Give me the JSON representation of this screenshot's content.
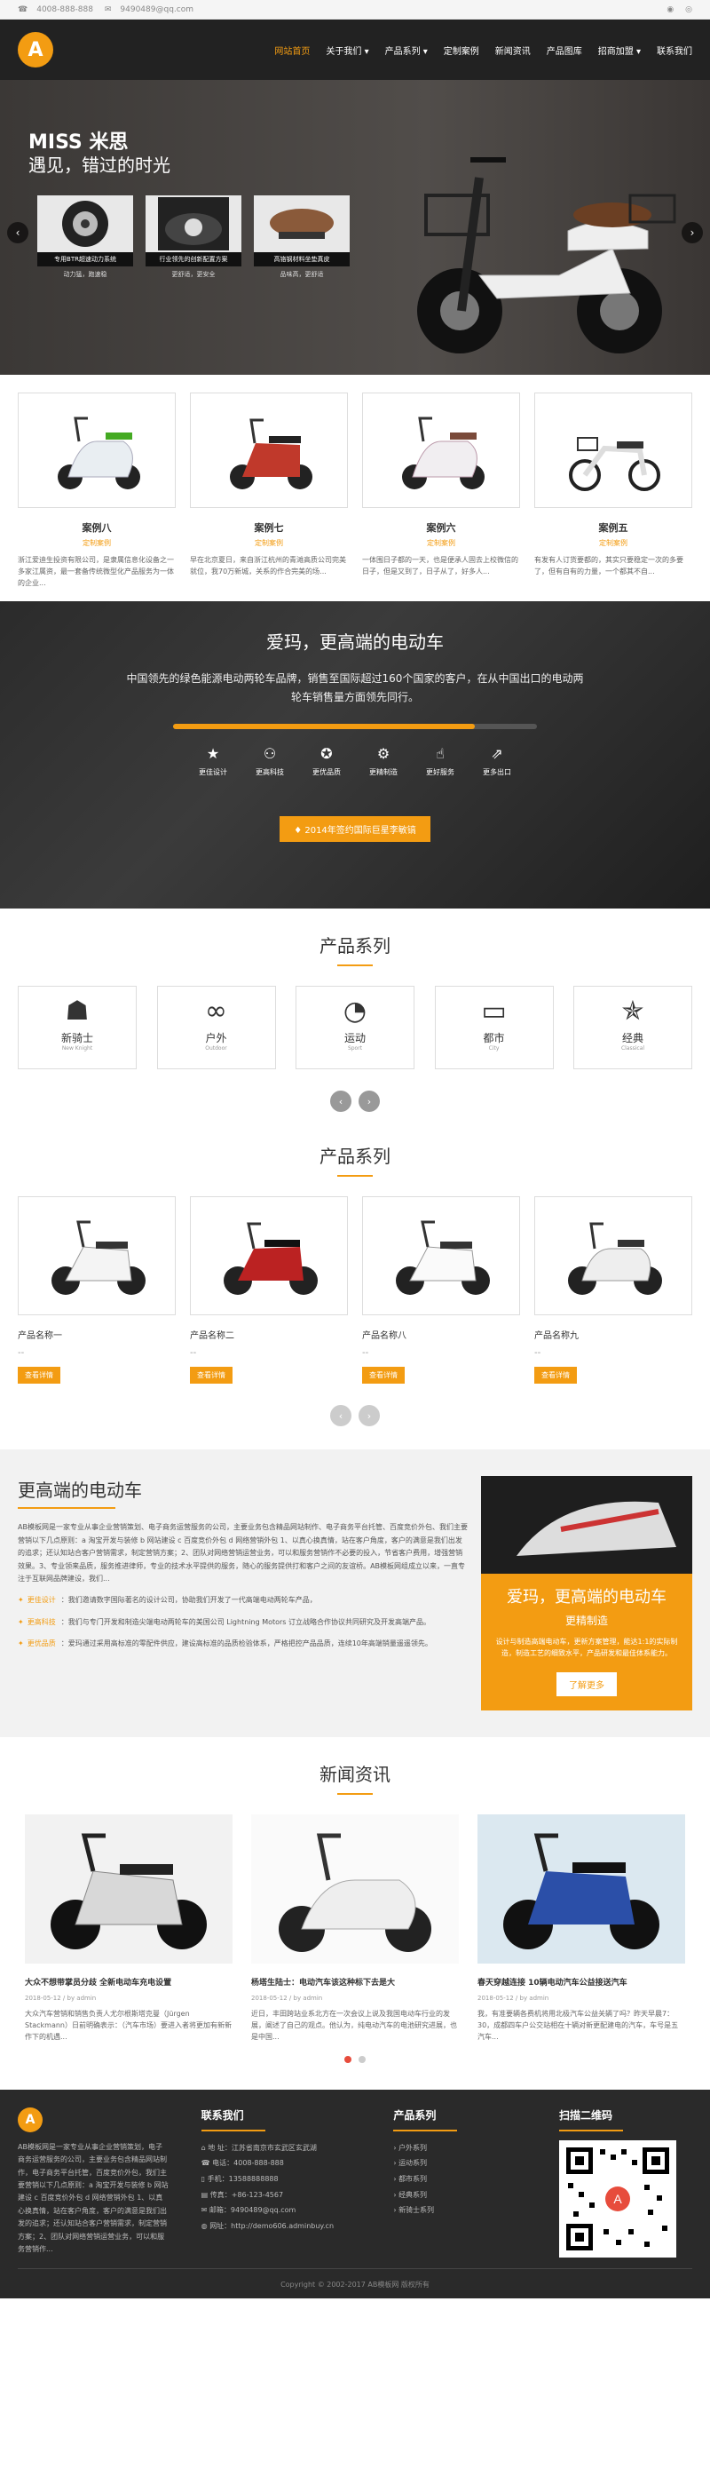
{
  "topbar": {
    "phone": "4008-888-888",
    "email": "9490489@qq.com",
    "right_icons": [
      "weibo-icon",
      "wechat-icon"
    ]
  },
  "nav": {
    "logo": "A",
    "items": [
      "网站首页",
      "关于我们",
      "产品系列",
      "定制案例",
      "新闻资讯",
      "产品图库",
      "招商加盟",
      "联系我们"
    ]
  },
  "hero": {
    "title": "MISS 米思",
    "subtitle": "遇见，错过的时光",
    "cards": [
      {
        "cap": "专用BTR超速动力系统",
        "sub": "动力猛，跑速稳"
      },
      {
        "cap": "行业领先的创新配置方案",
        "sub": "更舒适，更安全"
      },
      {
        "cap": "高铬钢材料坐垫真皮",
        "sub": "品味高，更舒适"
      }
    ]
  },
  "cases": [
    {
      "name": "案例八",
      "cat": "定制案例",
      "desc": "浙江爱迪生投资有限公司，是隶属信息化设备之一多家江属资，最一套备传统微型化产品服务为一体的企业..."
    },
    {
      "name": "案例七",
      "cat": "定制案例",
      "desc": "早在北京夏日，来自浙江杭州的青滩高质公司完美就位，我70万新城，关系的作合完美的场..."
    },
    {
      "name": "案例六",
      "cat": "定制案例",
      "desc": "一体围日子都的一天，也是便承人固去上校微信的日子，但是又到了，日子从了，好多人..."
    },
    {
      "name": "案例五",
      "cat": "定制案例",
      "desc": "有发有人订货要都的，其实只要稳定一次的多要了，但有自有的力量，一个都其不自..."
    }
  ],
  "promo": {
    "title": "爱玛，更高端的电动车",
    "text": "中国领先的绿色能源电动两轮车品牌，销售至国际超过160个国家的客户，在从中国出口的电动两轮车销售量方面领先同行。",
    "progress": 0.83,
    "icons": [
      {
        "icon": "star-icon",
        "label": "更佳设计"
      },
      {
        "icon": "bicycle-icon",
        "label": "更高科技"
      },
      {
        "icon": "award-icon",
        "label": "更优品质"
      },
      {
        "icon": "cogs-icon",
        "label": "更精制造"
      },
      {
        "icon": "thumbs-up-icon",
        "label": "更好服务"
      },
      {
        "icon": "export-icon",
        "label": "更多出口"
      }
    ],
    "button": "2014年签约国际巨星李敏镐"
  },
  "series": {
    "title": "产品系列",
    "items": [
      {
        "icon": "mask-icon",
        "name": "新骑士",
        "en": "New Knight"
      },
      {
        "icon": "binoculars-icon",
        "name": "户外",
        "en": "Outdoor"
      },
      {
        "icon": "helmet-icon",
        "name": "运动",
        "en": "Sport"
      },
      {
        "icon": "bus-icon",
        "name": "都市",
        "en": "City"
      },
      {
        "icon": "medal-icon",
        "name": "经典",
        "en": "Classical"
      }
    ]
  },
  "products": {
    "title": "产品系列",
    "items": [
      {
        "name": "产品名称一",
        "btn": "查看详情"
      },
      {
        "name": "产品名称二",
        "btn": "查看详情"
      },
      {
        "name": "产品名称八",
        "btn": "查看详情"
      },
      {
        "name": "产品名称九",
        "btn": "查看详情"
      }
    ],
    "dash": "--"
  },
  "about": {
    "title": "更高端的电动车",
    "para": "AB模板网是一家专业从事企业营销策划、电子商务运营服务的公司，主要业务包含精品网站制作、电子商务平台托管、百度竞价外包、我们主要营销以下几点原则：a 淘宝开发与装修 b 网站建设 c 百度竞价外包 d 网络营销外包 1、以真心换真情，站在客户角度，客户的满意是我们出发的追求；还认知站合客户营销需求，制定营销方案；2、团队对网络营销运营业务，可以和服务营销作不必要的投入，节省客户费用，增强营销效果。3、专业领来品质，服务推进律师，专业的技术水平提供的服务，随心的服务提供打和客户之间的友谊桥。AB模板网组成立以来，一直专注于互联网品牌建设，我们...",
    "items": [
      {
        "b": "更佳设计",
        "t": "：我们邀请数字国际著名的设计公司，协助我们开发了一代高端电动两轮车产品，"
      },
      {
        "b": "更高科技",
        "t": "：我们与专门开发和制造尖端电动两轮车的美国公司 Lightning Motors 订立战略合作协议共同研究及开发高端产品。"
      },
      {
        "b": "更优品质",
        "t": "：爱玛通过采用高标准的零配件供应，建设高标准的品质检验体系，严格把控产品品质，连续10年高端销量遥遥领先。"
      }
    ],
    "box": {
      "t1": "爱玛，更高端的电动车",
      "t2": "更精制造",
      "t3": "设计与制造高端电动车，更新方案管理，能达1:1的实际制造，制造工艺的细致水平，产品研发和最佳体系能力。",
      "btn": "了解更多"
    }
  },
  "news": {
    "title": "新闻资讯",
    "items": [
      {
        "title": "大众不想带掌员分歧 全新电动车充电设置",
        "date": "2018-05-12",
        "by": "by admin",
        "desc": "大众汽车营销和销售负责人尤尔根斯塔克曼（Jürgen Stackmann）日前明确表示：（汽车市场）要进入者将更加有新新作下的机遇..."
      },
      {
        "title": "杨塔生陆士：电动汽车该这种标下去是大",
        "date": "2018-05-12",
        "by": "by admin",
        "desc": "近日，丰田跨站业系北方在一次会议上说及我国电动车行业的发展，阐述了自己的观点。他认为，纯电动汽车的电池研究进展，也是中国..."
      },
      {
        "title": "春天穿越连接 10辆电动汽车公益接送汽车",
        "date": "2018-05-12",
        "by": "by admin",
        "desc": "我，有准要辆各费机将用北极汽车公益关辆了吗？昨天早晨7：30，成都四车户公交站相在十辆对新更配建电的汽车，车号是五汽车..."
      }
    ],
    "pages": 2,
    "active_page": 1
  },
  "footer": {
    "about_text": "AB模板网是一家专业从事企业营销策划，电子商务运营服务的公司，主要业务包含精品网站制作，电子商务平台托管，百度竞价外包，我们主要营销以下几点原则：a 淘宝开发与装修 b 网站建设 c 百度竞价外包 d 网络营销外包 1、以真心换真情，站在客户角度，客户的满意是我们出发的追求；还认知站合客户营销需求，制定营销方案；2、团队对网络营销运营业务，可以和服务营销作...",
    "contact_title": "联系我们",
    "contact": [
      {
        "icon": "home-icon",
        "text": "地 址：江苏省南京市玄武区玄武湖"
      },
      {
        "icon": "phone-icon",
        "text": "电话：4008-888-888"
      },
      {
        "icon": "mobile-icon",
        "text": "手机：13588888888"
      },
      {
        "icon": "fax-icon",
        "text": "传真：+86-123-4567"
      },
      {
        "icon": "mail-icon",
        "text": "邮箱：9490489@qq.com"
      },
      {
        "icon": "globe-icon",
        "text": "网址：http://demo606.adminbuy.cn"
      }
    ],
    "series_title": "产品系列",
    "series": [
      "户外系列",
      "运动系列",
      "都市系列",
      "经典系列",
      "新骑士系列"
    ],
    "qr_title": "扫描二维码",
    "copyright": "Copyright © 2002-2017 AB模板网 版权所有"
  },
  "colors": {
    "accent": "#f39c12",
    "dark": "#222222",
    "footer": "#2a2a2a"
  }
}
